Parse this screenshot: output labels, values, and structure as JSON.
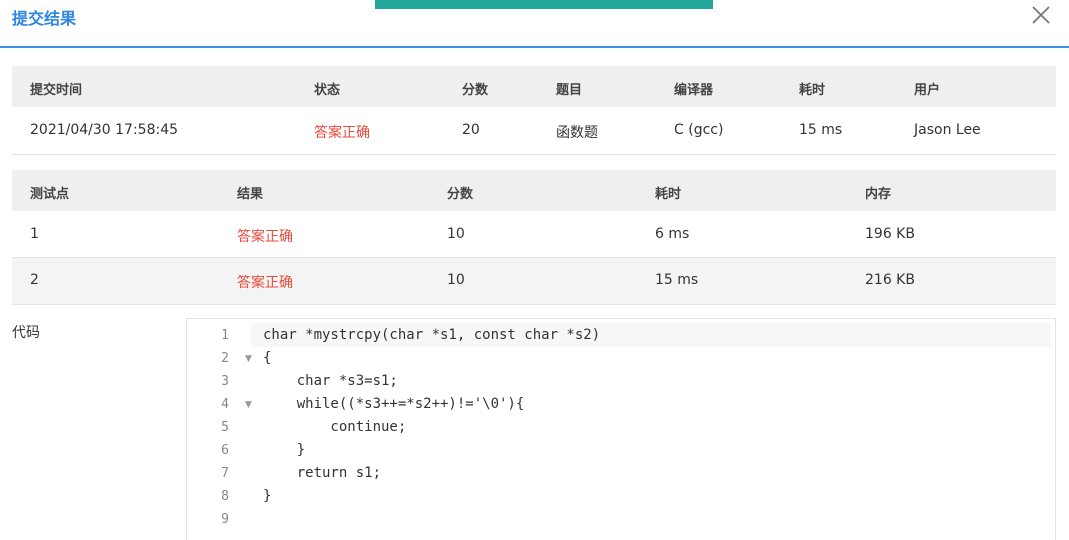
{
  "header": {
    "title": "提交结果"
  },
  "summary": {
    "columns": [
      "提交时间",
      "状态",
      "分数",
      "题目",
      "编译器",
      "耗时",
      "用户"
    ],
    "row": {
      "time": "2021/04/30 17:58:45",
      "status": "答案正确",
      "score": "20",
      "problem": "函数题",
      "compiler": "C (gcc)",
      "duration": "15 ms",
      "user": "Jason Lee"
    }
  },
  "tests": {
    "columns": [
      "测试点",
      "结果",
      "分数",
      "耗时",
      "内存"
    ],
    "rows": [
      {
        "id": "1",
        "result": "答案正确",
        "score": "10",
        "duration": "6 ms",
        "memory": "196 KB"
      },
      {
        "id": "2",
        "result": "答案正确",
        "score": "10",
        "duration": "15 ms",
        "memory": "216 KB"
      }
    ]
  },
  "code": {
    "label": "代码",
    "line_numbers": [
      "1",
      "2",
      "3",
      "4",
      "5",
      "6",
      "7",
      "8",
      "9"
    ],
    "lines": [
      "char *mystrcpy(char *s1, const char *s2)",
      "{",
      "    char *s3=s1;",
      "    while((*s3++=*s2++)!='\\0'){",
      "        continue;",
      "    }",
      "    return s1;",
      "}",
      ""
    ]
  },
  "colors": {
    "accent": "#2f86e3",
    "green_bar": "#21a697",
    "status_ok": "#e64a3b"
  }
}
